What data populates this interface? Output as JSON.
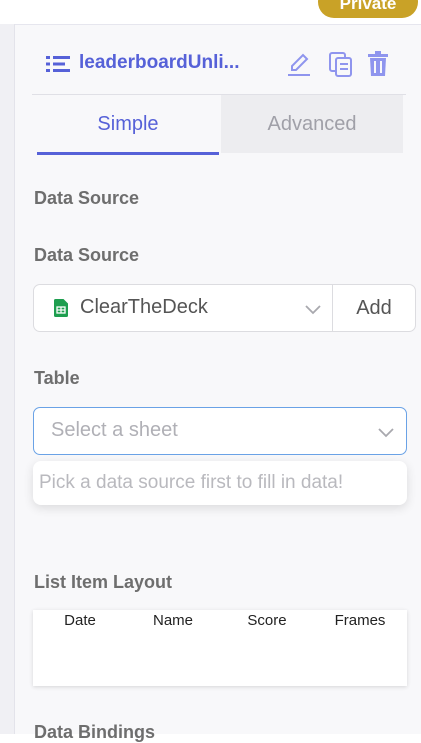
{
  "badge": {
    "label": "Private"
  },
  "header": {
    "title": "leaderboardUnli...",
    "icons": [
      "list-icon",
      "edit-icon",
      "copy-icon",
      "trash-icon"
    ]
  },
  "tabs": [
    {
      "label": "Simple",
      "active": true
    },
    {
      "label": "Advanced",
      "active": false
    }
  ],
  "sections": {
    "data_source_heading": "Data Source",
    "data_source_label": "Data Source",
    "table_label": "Table",
    "list_item_layout_label": "List Item Layout",
    "data_bindings_label": "Data Bindings"
  },
  "data_source": {
    "value": "ClearTheDeck",
    "icon": "google-sheets-icon",
    "add_label": "Add"
  },
  "table": {
    "placeholder": "Select a sheet"
  },
  "hint": {
    "text": "Pick a data source first to fill in data!"
  },
  "layout_preview": {
    "columns": [
      "Date",
      "Name",
      "Score",
      "Frames"
    ]
  },
  "colors": {
    "accent": "#5661d8",
    "badge": "#c9a227",
    "sheets_green": "#1e9e4f",
    "focus_border": "#6aa2e6"
  }
}
